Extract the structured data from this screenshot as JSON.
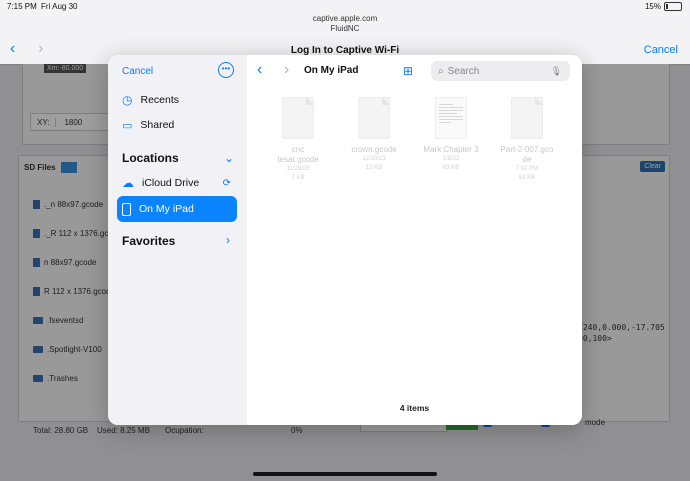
{
  "status": {
    "time": "7:15 PM",
    "date": "Fri Aug 30",
    "battery": "15%",
    "battery_level": 0.15
  },
  "nav": {
    "url": "captive.apple.com",
    "site": "FluidNC",
    "title": "Log In to Captive Wi-Fi",
    "cancel": "Cancel"
  },
  "background": {
    "xm_badge": "Xm:-80.000",
    "xy_label": "XY:",
    "xy_value": "1800",
    "sd_title": "SD Files",
    "clear": "Clear",
    "files": [
      "._n 88x97.gcode",
      "._R 112 x 1376.gco",
      "n 88x97.gcode",
      "R 112 x 1376.gcod"
    ],
    "folders": [
      ".fseventsd",
      ".Spotlight-V100",
      ".Trashes"
    ],
    "console_line1": ".240,0.000,-17.705",
    "console_line2": "00,100>",
    "total": "Total: 28.80 GB",
    "used": "Used: 8.25 MB",
    "occupation_label": "Ocupation:",
    "occupation_value": "0%",
    "mode": "mode"
  },
  "sidebar": {
    "cancel": "Cancel",
    "recents": "Recents",
    "shared": "Shared",
    "locations_title": "Locations",
    "icloud": "iCloud Drive",
    "on_my_ipad": "On My iPad",
    "favorites_title": "Favorites"
  },
  "browser": {
    "location": "On My iPad",
    "search_placeholder": "Search",
    "files": [
      {
        "name_line1": "cnc",
        "name_line2": "tesat.gcode",
        "date": "11/29/23",
        "size": "7 KB"
      },
      {
        "name_line1": "crown.gcode",
        "name_line2": "",
        "date": "12/10/23",
        "size": "13 KB"
      },
      {
        "name_line1": "Mark Chapter 3",
        "name_line2": "",
        "date": "1/8/22",
        "size": "63 KB"
      },
      {
        "name_line1": "Part-2-007.gco",
        "name_line2": "de",
        "date": "7:02 PM",
        "size": "63 KB"
      }
    ],
    "item_count": "4 items"
  },
  "colors": {
    "accent": "#0a84ff",
    "selected_bg": "#0a84ff"
  }
}
